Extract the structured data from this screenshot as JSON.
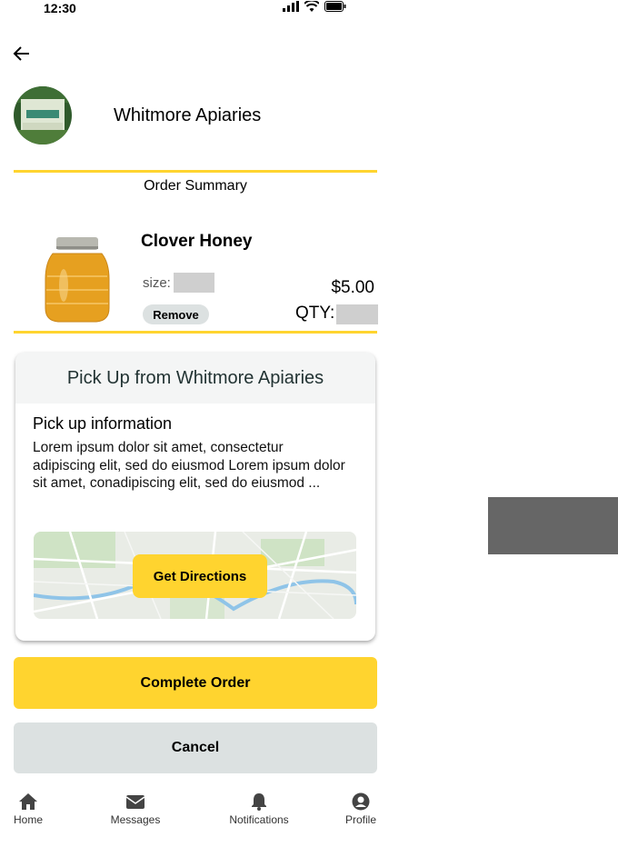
{
  "status_bar": {
    "time": "12:30"
  },
  "store": {
    "name": "Whitmore Apiaries"
  },
  "summary": {
    "title": "Order Summary"
  },
  "product": {
    "name": "Clover Honey",
    "size_label": "size:",
    "remove_label": "Remove",
    "price": "$5.00",
    "qty_label": "QTY:"
  },
  "pickup": {
    "header": "Pick Up from Whitmore Apiaries",
    "info_title": "Pick up information",
    "info_text": "Lorem ipsum dolor sit amet, consectetur adipiscing elit, sed do eiusmod Lorem ipsum dolor sit amet, conadipiscing elit, sed do eiusmod ...",
    "directions_label": "Get Directions"
  },
  "actions": {
    "complete_label": "Complete Order",
    "cancel_label": "Cancel"
  },
  "nav": [
    {
      "label": "Home",
      "icon": "home-icon"
    },
    {
      "label": "Messages",
      "icon": "envelope-icon"
    },
    {
      "label": "Notifications",
      "icon": "bell-icon"
    },
    {
      "label": "Profile",
      "icon": "user-circle-icon"
    }
  ],
  "colors": {
    "accent": "#FFD42F",
    "secondary": "#DCE1E1",
    "card_header": "#F4F5F5"
  }
}
